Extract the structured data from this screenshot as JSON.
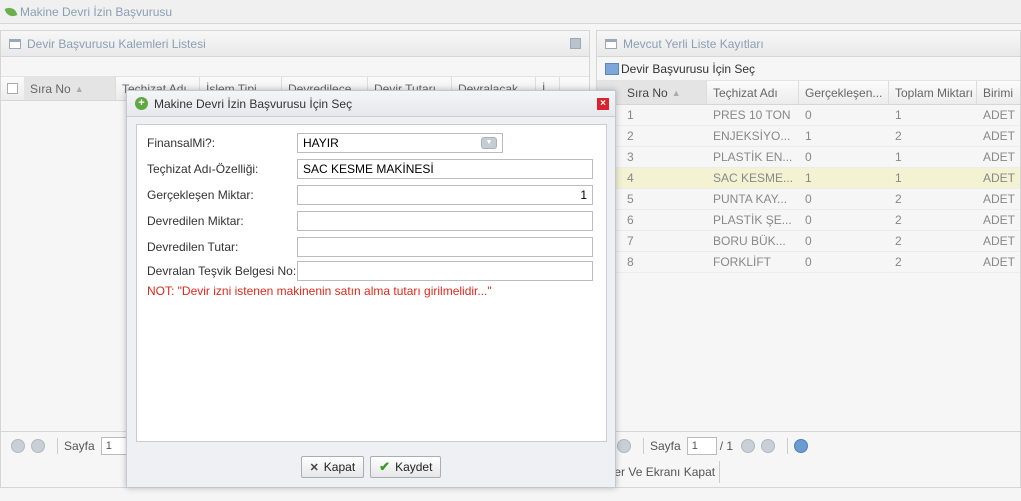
{
  "app": {
    "title": "Makine Devri İzin Başvurusu"
  },
  "left_panel": {
    "title": "Devir Başvurusu Kalemleri Listesi",
    "columns": [
      "Sıra No",
      "Teçhizat Adı",
      "İşlem Tipi",
      "Devredilece",
      "Devir Tutarı",
      "Devralacak",
      "İ"
    ],
    "pager": {
      "label": "Sayfa",
      "value": "1"
    }
  },
  "right_panel": {
    "title": "Mevcut Yerli Liste Kayıtları",
    "toolbar_label": "Devir Başvurusu İçin Seç",
    "columns": [
      "Sıra No",
      "Teçhizat Adı",
      "Gerçekleşen...",
      "Toplam Miktarı",
      "Birimi"
    ],
    "rows": [
      {
        "no": "1",
        "name": "PRES 10 TON",
        "realized": "0",
        "total": "1",
        "unit": "ADET"
      },
      {
        "no": "2",
        "name": "ENJEKSİYO...",
        "realized": "1",
        "total": "2",
        "unit": "ADET"
      },
      {
        "no": "3",
        "name": "PLASTİK EN...",
        "realized": "0",
        "total": "1",
        "unit": "ADET"
      },
      {
        "no": "4",
        "name": "SAC KESME...",
        "realized": "1",
        "total": "1",
        "unit": "ADET"
      },
      {
        "no": "5",
        "name": "PUNTA KAY...",
        "realized": "0",
        "total": "2",
        "unit": "ADET"
      },
      {
        "no": "6",
        "name": "PLASTİK ŞE...",
        "realized": "0",
        "total": "2",
        "unit": "ADET"
      },
      {
        "no": "7",
        "name": "BORU BÜK...",
        "realized": "0",
        "total": "2",
        "unit": "ADET"
      },
      {
        "no": "8",
        "name": "FORKLİFT",
        "realized": "0",
        "total": "2",
        "unit": "ADET"
      }
    ],
    "selected_row": "4",
    "pager": {
      "label": "Sayfa",
      "value": "1",
      "total": "/ 1"
    },
    "footer_button": "nder Ve Ekranı Kapat"
  },
  "dialog": {
    "title": "Makine Devri İzin Başvurusu İçin Seç",
    "fields": {
      "finansal_label": "FinansalMi?:",
      "finansal_value": "HAYIR",
      "techizat_label": "Teçhizat Adı-Özelliği:",
      "techizat_value": "SAC KESME MAKİNESİ",
      "gerceklesen_label": "Gerçekleşen Miktar:",
      "gerceklesen_value": "1",
      "devredilen_miktar_label": "Devredilen Miktar:",
      "devredilen_miktar_value": "",
      "devredilen_tutar_label": "Devredilen Tutar:",
      "devredilen_tutar_value": "",
      "tesvik_label": "Devralan Teşvik Belgesi No:",
      "tesvik_value": ""
    },
    "note": "NOT: \"Devir izni istenen makinenin satın alma tutarı girilmelidir...\"",
    "buttons": {
      "close": "Kapat",
      "save": "Kaydet"
    }
  }
}
